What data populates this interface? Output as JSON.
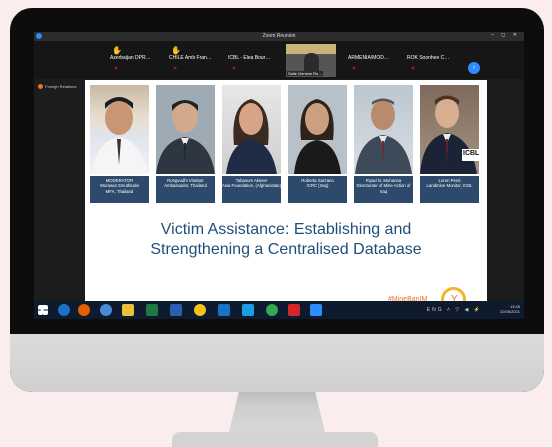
{
  "window": {
    "title": "Zoom Reunion",
    "controls": "– ◻ ✕"
  },
  "participants": [
    {
      "name": "Azerbaijan DPR…",
      "hand": true
    },
    {
      "name": "CHILE Amb Fran…",
      "hand": true
    },
    {
      "name": "ICBL - Elea Bour…",
      "hand": false
    },
    {
      "name": "ROK Soonhee C…",
      "hand": false
    }
  ],
  "video_tile": {
    "label": "Salle Geneve Ro…"
  },
  "armenia": {
    "name": "ARMENIA/MOD…"
  },
  "sidebar": {
    "label": "Foreign Relations"
  },
  "speakers": [
    {
      "role": "MODERATOR",
      "name": "Worawut Smuthkalin",
      "org": "MFA, Thailand"
    },
    {
      "role": "",
      "name": "Rongvudhi Virabutr",
      "org": "Ambassador, Thailand"
    },
    {
      "role": "",
      "name": "Tabasum Akseer",
      "org": "Asia Foundation, (Afghanistan)"
    },
    {
      "role": "",
      "name": "Roberta Sarzano",
      "org": "ICRC (Iraq)"
    },
    {
      "role": "",
      "name": "Riyad N. Muhanna",
      "org": "Directorate of Mine Action of Iraq"
    },
    {
      "role": "",
      "name": "Loren Persi",
      "org": "Landmine Monitor, ICBL"
    }
  ],
  "slide": {
    "title_line1": "Victim Assistance: Establishing and",
    "title_line2": "Strengthening a Centralised Database",
    "hashtag": "#MineBanIM",
    "icbl_badge": "ICBL"
  },
  "tray": {
    "time": "13:45",
    "date": "22/06/2021",
    "lang": "ENG"
  }
}
